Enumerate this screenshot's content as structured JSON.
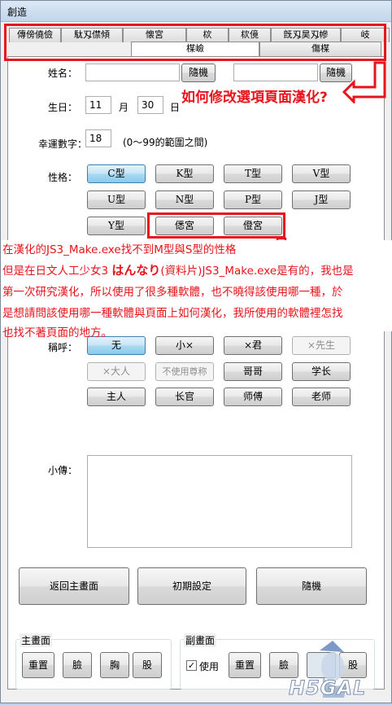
{
  "window": {
    "title": "創造"
  },
  "tabs_row1": [
    "傳傍僥儉",
    "駄刄僸傾",
    "懐宮",
    "栨",
    "栨傹",
    "旣刄昊刄幓",
    "岐"
  ],
  "tabs_row2": [
    "楳嶮",
    "傷楳"
  ],
  "form": {
    "name_label": "姓名：",
    "random_label": "隨機",
    "birthday_label": "生日：",
    "month_value": "11",
    "month_label": "月",
    "day_value": "30",
    "day_label": "日",
    "lucky_label": "幸運數字：",
    "lucky_value": "18",
    "lucky_hint": "(0～99的範圍之間)",
    "personality_label": "性格：",
    "personality": [
      "C型",
      "K型",
      "T型",
      "V型",
      "U型",
      "N型",
      "P型",
      "J型",
      "Y型",
      "僁宮",
      "僜宮"
    ],
    "honorific_label": "稱呼：",
    "honorifics": [
      "无",
      "小×",
      "×君",
      "×先生",
      "×大人",
      "不使用尊称",
      "哥哥",
      "学长",
      "主人",
      "长官",
      "师傅",
      "老师"
    ],
    "bio_label": "小傳："
  },
  "bottom_buttons": [
    "返回主畫面",
    "初期設定",
    "隨機"
  ],
  "main_screen": {
    "caption": "主畫面",
    "buttons": [
      "重置",
      "臉",
      "胸",
      "股"
    ]
  },
  "sub_screen": {
    "caption": "副畫面",
    "use_label": "使用",
    "use_checked": "✓",
    "buttons": [
      "重置",
      "臉",
      "股"
    ]
  },
  "annotation": {
    "question": "如何修改選項頁面漢化?",
    "line1": "在漢化的JS3_Make.exe找不到M型與S型的性格",
    "line2a": "但是在日文人工少女3 ",
    "line2b": "はんなり",
    "line2c": "(資料片)JS3_Make.exe是有的，我也是",
    "line3": "第一次研究漢化，所以使用了很多種軟體，也不曉得該使用哪一種，於",
    "line4": "是想請問該使用哪一種軟體與頁面上如何漢化，我所使用的軟體裡怎找",
    "line5": "也找不著頁面的地方。"
  },
  "watermark": "H5GAL",
  "colors": {
    "annotation": "#e8141b",
    "selected": "#8ccaeb"
  }
}
